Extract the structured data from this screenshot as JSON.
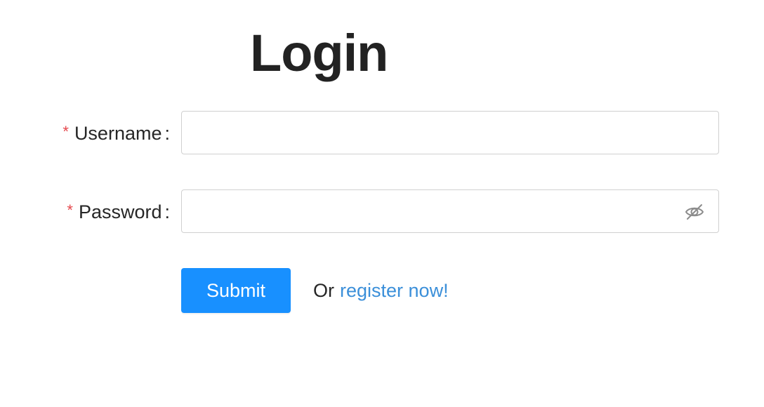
{
  "title": "Login",
  "form": {
    "username": {
      "required_mark": "*",
      "label": "Username",
      "colon": ":",
      "value": "",
      "placeholder": ""
    },
    "password": {
      "required_mark": "*",
      "label": "Password",
      "colon": ":",
      "value": "",
      "placeholder": "",
      "visibility_icon": "eye-invisible-icon"
    },
    "submit_label": "Submit",
    "or_text": "Or",
    "register_link": "register now!"
  },
  "colors": {
    "primary": "#1890ff",
    "link": "#3b8fd9",
    "required": "#e5484d",
    "border": "#d0d0d0"
  }
}
